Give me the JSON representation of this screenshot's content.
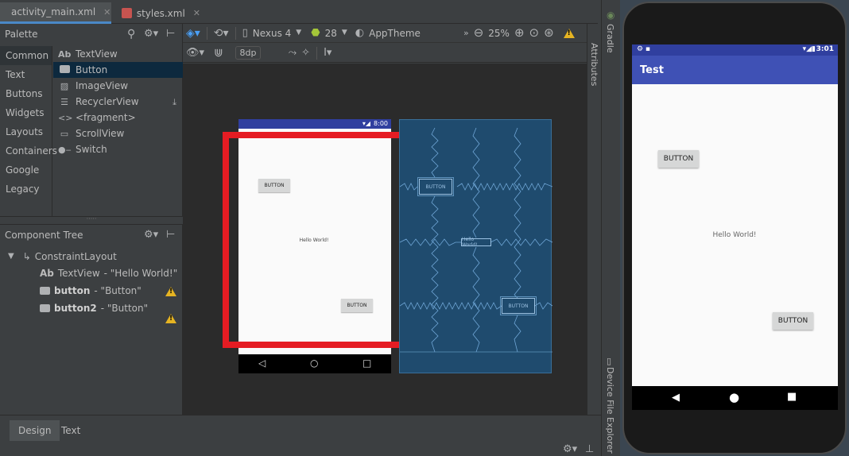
{
  "tabs": [
    {
      "label": "activity_main.xml",
      "active": true
    },
    {
      "label": "styles.xml",
      "active": false
    }
  ],
  "palette": {
    "title": "Palette",
    "categories": [
      "Common",
      "Text",
      "Buttons",
      "Widgets",
      "Layouts",
      "Containers",
      "Google",
      "Legacy"
    ],
    "items": [
      {
        "icon": "Ab",
        "label": "TextView"
      },
      {
        "icon": "button-icon",
        "label": "Button"
      },
      {
        "icon": "image-icon",
        "label": "ImageView"
      },
      {
        "icon": "list-icon",
        "label": "RecyclerView"
      },
      {
        "icon": "code-icon",
        "label": "<fragment>"
      },
      {
        "icon": "scroll-icon",
        "label": "ScrollView"
      },
      {
        "icon": "switch-icon",
        "label": "Switch"
      }
    ]
  },
  "component_tree": {
    "title": "Component Tree",
    "root": "ConstraintLayout",
    "textview_icon": "Ab",
    "children": [
      {
        "name": "TextView",
        "text": "- \"Hello World!\"",
        "warning": false
      },
      {
        "name": "button",
        "text": "- \"Button\"",
        "warning": true
      },
      {
        "name": "button2",
        "text": "- \"Button\"",
        "warning": true
      }
    ]
  },
  "toolbar": {
    "device": "Nexus 4",
    "api": "28",
    "theme": "AppTheme",
    "zoom": "25%",
    "margin": "8dp"
  },
  "design": {
    "time": "8:00",
    "button1": "BUTTON",
    "hello": "Hello World!",
    "button2": "BUTTON",
    "bp_button": "BUTTON",
    "bp_hello": "Hello World!"
  },
  "side": {
    "gradle": "Gradle",
    "attributes": "Attributes",
    "device_explorer": "Device File Explorer"
  },
  "bottom_tabs": [
    "Design",
    "Text"
  ],
  "emulator": {
    "time": "3:01",
    "app_title": "Test",
    "button1": "BUTTON",
    "hello": "Hello World!",
    "button2": "BUTTON",
    "appbar_color": "#3f51b5",
    "statusbar_color": "#303f9f"
  },
  "highlight_color": "#e51c23"
}
